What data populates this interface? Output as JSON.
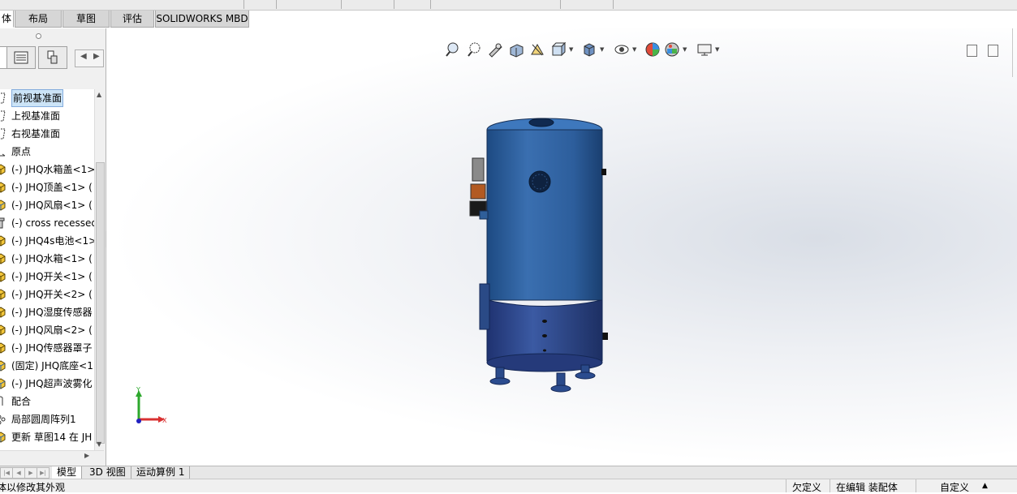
{
  "command_tabs": [
    "体",
    "布局",
    "草图",
    "评估",
    "SOLIDWORKS MBD"
  ],
  "tree": {
    "items": [
      {
        "label": "前视基准面",
        "icon": "plane-icon",
        "selected": true
      },
      {
        "label": "上视基准面",
        "icon": "plane-icon"
      },
      {
        "label": "右视基准面",
        "icon": "plane-icon"
      },
      {
        "label": "原点",
        "icon": "origin-icon"
      },
      {
        "label": "(-) JHQ水箱盖<1>",
        "icon": "part-icon"
      },
      {
        "label": "(-) JHQ顶盖<1> (",
        "icon": "part-icon"
      },
      {
        "label": "(-) JHQ风扇<1> (",
        "icon": "assembly-icon"
      },
      {
        "label": "(-) cross recessed",
        "icon": "toolbox-part-icon"
      },
      {
        "label": "(-) JHQ4s电池<1>",
        "icon": "part-icon"
      },
      {
        "label": "(-) JHQ水箱<1> (",
        "icon": "part-icon"
      },
      {
        "label": "(-) JHQ开关<1> (",
        "icon": "part-icon"
      },
      {
        "label": "(-) JHQ开关<2> (",
        "icon": "part-icon"
      },
      {
        "label": "(-) JHQ湿度传感器",
        "icon": "part-icon"
      },
      {
        "label": "(-) JHQ风扇<2> (",
        "icon": "part-icon"
      },
      {
        "label": "(-) JHQ传感器罩子",
        "icon": "part-icon"
      },
      {
        "label": "(固定) JHQ底座<1",
        "icon": "assembly-icon"
      },
      {
        "label": "(-) JHQ超声波雾化",
        "icon": "assembly-icon"
      },
      {
        "label": "配合",
        "icon": "mates-icon"
      },
      {
        "label": "局部圆周阵列1",
        "icon": "pattern-icon"
      },
      {
        "label": "更新 草图14 在 JH",
        "icon": "assembly-icon"
      }
    ]
  },
  "triad": {
    "x_label": "X",
    "y_label": "Y"
  },
  "bottom_tabs": [
    "模型",
    "3D 视图",
    "运动算例 1"
  ],
  "status": {
    "hint": "体以修改其外观",
    "definition": "欠定义",
    "editing": "在编辑 装配体",
    "custom": "自定义",
    "up_arrow": "▲"
  },
  "colors": {
    "tank_body": "#2f5f9a",
    "tank_lower": "#2b4a8a",
    "selection": "#cce4f7"
  }
}
